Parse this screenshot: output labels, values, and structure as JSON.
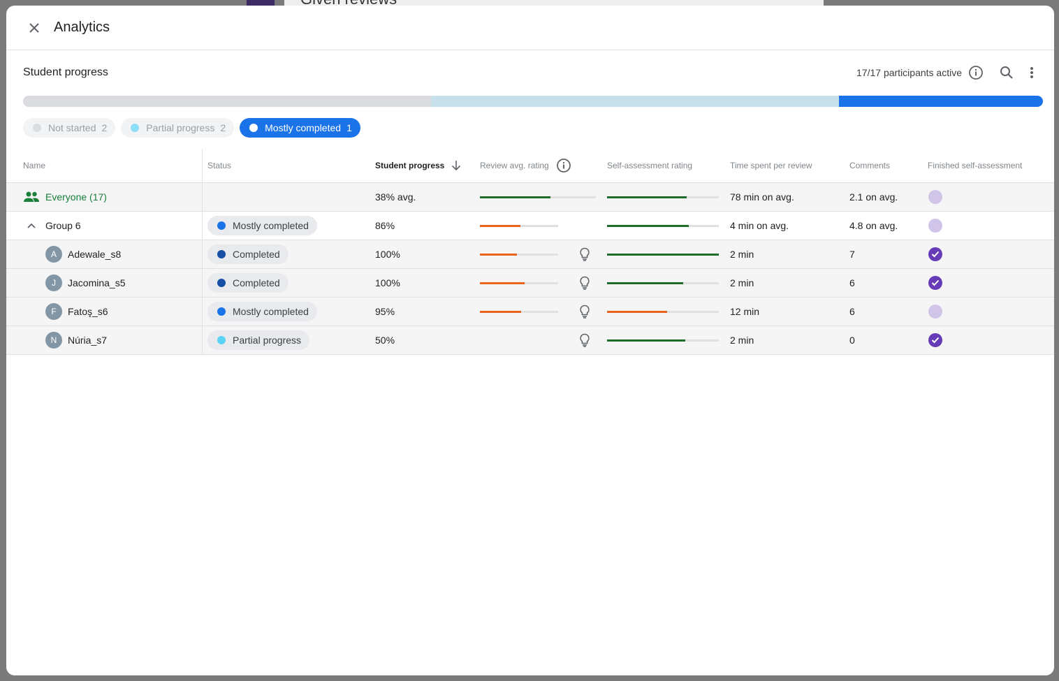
{
  "background": {
    "title": "Given reviews"
  },
  "modal": {
    "title": "Analytics"
  },
  "section": {
    "title": "Student progress",
    "participants_active": "17/17 participants active"
  },
  "progress_bar": [
    {
      "status": "Not started",
      "fraction": 0.4,
      "color": "#dadce0"
    },
    {
      "status": "Partial progress",
      "fraction": 0.4,
      "color": "#c7e1ea"
    },
    {
      "status": "Mostly completed",
      "fraction": 0.2,
      "color": "#1a73e8"
    }
  ],
  "filters": [
    {
      "label": "Not started",
      "count": "2",
      "dot_color": "#dadce0",
      "active": false
    },
    {
      "label": "Partial progress",
      "count": "2",
      "dot_color": "#8fdef9",
      "active": false
    },
    {
      "label": "Mostly completed",
      "count": "1",
      "dot_color": "#ffffff",
      "active": true
    }
  ],
  "columns": {
    "name": "Name",
    "status": "Status",
    "student_progress": "Student progress",
    "review_avg_rating": "Review avg. rating",
    "self_assessment_rating": "Self-assessment rating",
    "time_spent": "Time spent per review",
    "comments": "Comments",
    "finished_self_assessment": "Finished self-assessment"
  },
  "colors": {
    "green": "#1e6b2a",
    "orange": "#e8631e",
    "completed": "#174ea6",
    "mostly": "#1a73e8",
    "partial": "#5bd3f6"
  },
  "everyone": {
    "label": "Everyone (17)",
    "progress": "38% avg.",
    "review_rating": {
      "value": 0.61,
      "color": "green"
    },
    "self_rating": {
      "value": 0.71,
      "color": "green"
    },
    "time": "78 min on avg.",
    "comments": "2.1 on avg.",
    "finished": false
  },
  "group": {
    "label": "Group 6",
    "status": "Mostly completed",
    "status_color": "mostly",
    "progress": "86%",
    "review_rating": {
      "value": 0.52,
      "color": "orange"
    },
    "self_rating": {
      "value": 0.73,
      "color": "green"
    },
    "time": "4 min on avg.",
    "comments": "4.8 on avg.",
    "finished": false
  },
  "students": [
    {
      "initial": "A",
      "name": "Adewale_s8",
      "status": "Completed",
      "status_color": "completed",
      "progress": "100%",
      "review_rating": {
        "value": 0.47,
        "color": "orange"
      },
      "self_rating": {
        "value": 1.0,
        "color": "green"
      },
      "time": "2 min",
      "comments": "7",
      "finished": true
    },
    {
      "initial": "J",
      "name": "Jacomina_s5",
      "status": "Completed",
      "status_color": "completed",
      "progress": "100%",
      "review_rating": {
        "value": 0.57,
        "color": "orange"
      },
      "self_rating": {
        "value": 0.68,
        "color": "green"
      },
      "time": "2 min",
      "comments": "6",
      "finished": true
    },
    {
      "initial": "F",
      "name": "Fatoş_s6",
      "status": "Mostly completed",
      "status_color": "mostly",
      "progress": "95%",
      "review_rating": {
        "value": 0.53,
        "color": "orange"
      },
      "self_rating": {
        "value": 0.54,
        "color": "orange"
      },
      "time": "12 min",
      "comments": "6",
      "finished": false
    },
    {
      "initial": "N",
      "name": "Núria_s7",
      "status": "Partial progress",
      "status_color": "partial",
      "progress": "50%",
      "review_rating": null,
      "self_rating": {
        "value": 0.7,
        "color": "green"
      },
      "time": "2 min",
      "comments": "0",
      "finished": true
    }
  ],
  "icons": {
    "close": "close-icon",
    "info": "info-icon",
    "search": "search-icon",
    "more": "more-vert-icon",
    "sort": "arrow-down-icon",
    "group": "people-icon",
    "collapse": "chevron-up-icon",
    "hint": "lightbulb-icon",
    "check": "check-circle-icon"
  }
}
